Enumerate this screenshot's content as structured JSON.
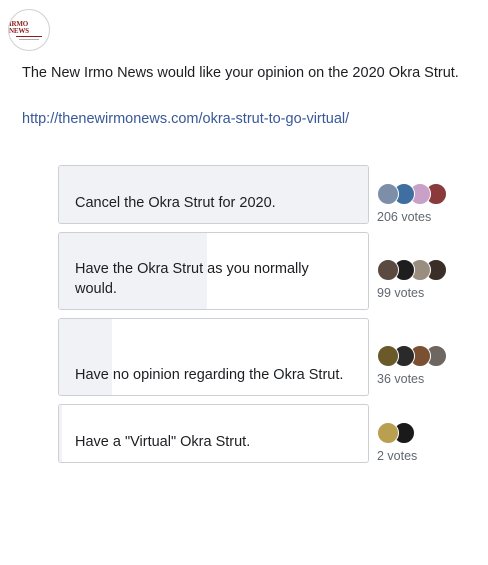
{
  "page": {
    "logo_text": "IRMO NEWS",
    "post_text": "The New Irmo News would like your opinion on the 2020 Okra Strut.",
    "link_text": "http://thenewirmonews.com/okra-strut-to-go-virtual/"
  },
  "poll": {
    "options": [
      {
        "label": "Cancel the Okra Strut for 2020.",
        "votes_text": "206 votes",
        "votes": 206,
        "fill_fraction": 1.0,
        "avatars": [
          "#7d8fa8",
          "#3f6fa0",
          "#c9a0c8",
          "#8a3a3a"
        ]
      },
      {
        "label": "Have the Okra Strut as you normally would.",
        "votes_text": "99 votes",
        "votes": 99,
        "fill_fraction": 0.48,
        "avatars": [
          "#5a4a40",
          "#1e1e1e",
          "#9a8e80",
          "#3a2e28"
        ]
      },
      {
        "label": "Have no opinion regarding the Okra Strut.",
        "votes_text": "36 votes",
        "votes": 36,
        "fill_fraction": 0.17,
        "avatars": [
          "#6a5a2a",
          "#2a2a2a",
          "#7a5030",
          "#6e6660"
        ]
      },
      {
        "label": "Have a \"Virtual\" Okra Strut.",
        "votes_text": "2 votes",
        "votes": 2,
        "fill_fraction": 0.01,
        "avatars": [
          "#b8a050",
          "#1a1a1a"
        ]
      }
    ]
  }
}
